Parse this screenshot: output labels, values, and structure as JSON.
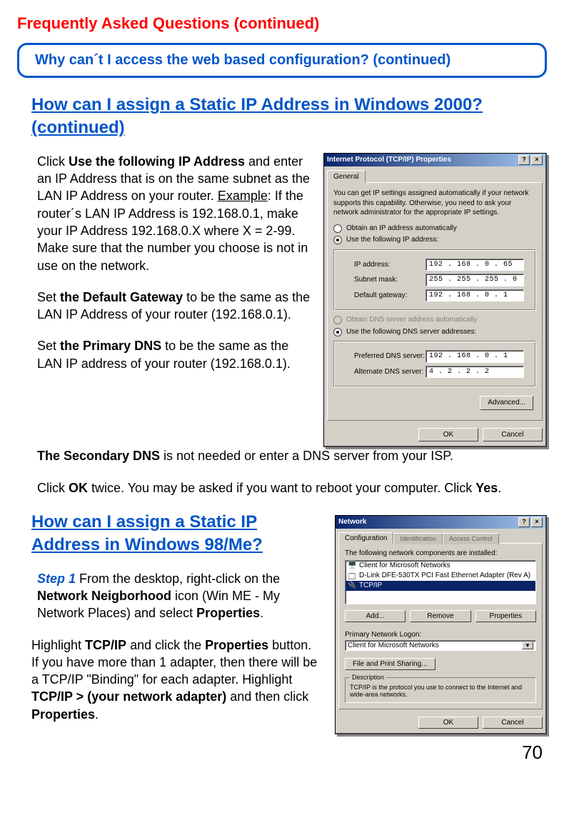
{
  "page_title": "Frequently Asked Questions (continued)",
  "callout": "Why can´t I access the web based configuration? (continued)",
  "section1": {
    "heading": "How can I assign a Static IP Address in Windows 2000? (continued)",
    "p1_a": "Click ",
    "p1_b": "Use the following IP Address",
    "p1_c": " and enter an IP Address that is on the same subnet as the LAN IP Address on your router. ",
    "p1_d": "Example",
    "p1_e": ": If the router´s LAN IP Address is 192.168.0.1, make your IP Address 192.168.0.X where X = 2-99. Make sure that the number you choose is not in use on the network.",
    "p2_a": "Set ",
    "p2_b": "the Default Gateway",
    "p2_c": " to be the same as the LAN IP Address of your router (192.168.0.1).",
    "p3_a": "Set ",
    "p3_b": "the Primary DNS",
    "p3_c": " to be the same as the LAN IP address of your router (192.168.0.1).",
    "p4_a": "The Secondary DNS",
    "p4_b": " is not needed or enter a DNS server from your ISP.",
    "p5_a": "Click ",
    "p5_b": "OK",
    "p5_c": " twice. You may be asked if you want to reboot your computer. Click ",
    "p5_d": "Yes",
    "p5_e": "."
  },
  "dialog1": {
    "title": "Internet Protocol (TCP/IP) Properties",
    "tab": "General",
    "intro": "You can get IP settings assigned automatically if your network supports this capability. Otherwise, you need to ask your network administrator for the appropriate IP settings.",
    "opt_auto_ip": "Obtain an IP address automatically",
    "opt_use_ip": "Use the following IP address:",
    "lbl_ip": "IP address:",
    "val_ip": "192 . 168 .  0  . 65",
    "lbl_mask": "Subnet mask:",
    "val_mask": "255 . 255 . 255 .  0",
    "lbl_gw": "Default gateway:",
    "val_gw": "192 . 168 .  0  .  1",
    "opt_auto_dns": "Obtain DNS server address automatically",
    "opt_use_dns": "Use the following DNS server addresses:",
    "lbl_pdns": "Preferred DNS server:",
    "val_pdns": "192 . 168 .  0  .  1",
    "lbl_adns": "Alternate DNS server:",
    "val_adns": "4  .  2  .  2  .  2",
    "btn_adv": "Advanced...",
    "btn_ok": "OK",
    "btn_cancel": "Cancel"
  },
  "section2": {
    "heading": "How can I assign a Static IP Address in Windows 98/Me?",
    "p1_a": "Step 1",
    "p1_b": " From the desktop, right-click on the ",
    "p1_c": "Network Neigborhood",
    "p1_d": " icon (Win ME - My Network Places) and select ",
    "p1_e": "Properties",
    "p1_f": ".",
    "p2_a": "Highlight ",
    "p2_b": "TCP/IP",
    "p2_c": " and click the ",
    "p2_d": "Properties",
    "p2_e": " button. If you have more than 1 adapter, then there will be a TCP/IP \"Binding\" for each adapter. Highlight ",
    "p2_f": "TCP/IP > (your network adapter)",
    "p2_g": " and then click ",
    "p2_h": "Properties",
    "p2_i": "."
  },
  "dialog2": {
    "title": "Network",
    "tab1": "Configuration",
    "tab2": "Identification",
    "tab3": "Access Control",
    "list_intro": "The following network components are installed:",
    "item1": "Client for Microsoft Networks",
    "item2": "D-Link DFE-530TX PCI Fast Ethernet Adapter (Rev A)",
    "item3": "TCP/IP",
    "btn_add": "Add...",
    "btn_remove": "Remove",
    "btn_props": "Properties",
    "lbl_logon": "Primary Network Logon:",
    "val_logon": "Client for Microsoft Networks",
    "btn_share": "File and Print Sharing...",
    "desc_label": "Description",
    "desc_text": "TCP/IP is the protocol you use to connect to the Internet and wide-area networks.",
    "btn_ok": "OK",
    "btn_cancel": "Cancel"
  },
  "page_number": "70"
}
